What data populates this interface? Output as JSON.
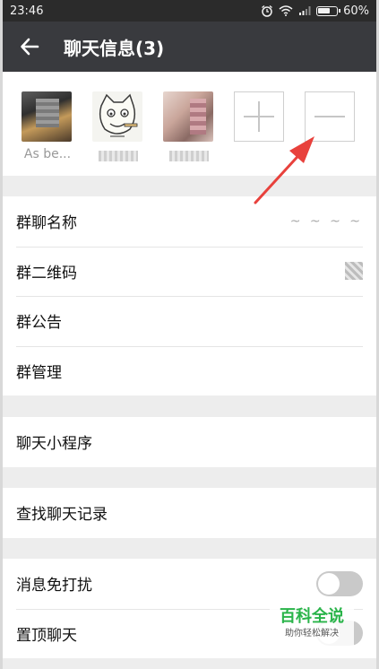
{
  "status_bar": {
    "time": "23:46",
    "battery": "60%",
    "icons": [
      "alarm-icon",
      "wifi-icon",
      "signal-icon",
      "battery-icon"
    ]
  },
  "header": {
    "title": "聊天信息(3)",
    "back_icon": "arrow-left-icon"
  },
  "members": [
    {
      "name": "As be..."
    },
    {
      "name": ""
    },
    {
      "name": ""
    }
  ],
  "member_actions": {
    "add_icon": "plus-icon",
    "remove_icon": "minus-icon"
  },
  "group_settings": {
    "name_label": "群聊名称",
    "name_value": "~ ~ ~ ~",
    "qr_label": "群二维码",
    "notice_label": "群公告",
    "manage_label": "群管理"
  },
  "mini_programs": {
    "label": "聊天小程序"
  },
  "search_history": {
    "label": "查找聊天记录"
  },
  "notifications": {
    "mute_label": "消息免打扰",
    "pin_label": "置顶聊天"
  },
  "watermark": {
    "main": "百科全说",
    "sub": "助你轻松解决"
  },
  "colors": {
    "status_bar": "#2b2b2b",
    "title_bar": "#393a3e",
    "background": "#ededed",
    "annotation_arrow": "#e8413c",
    "watermark_green": "#2ab44a"
  }
}
